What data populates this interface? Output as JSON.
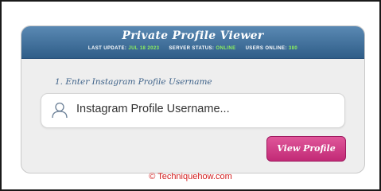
{
  "header": {
    "title": "Private Profile Viewer",
    "status": {
      "last_update_label": "LAST UPDATE:",
      "last_update_value": "JUL 18 2023",
      "server_status_label": "SERVER STATUS:",
      "server_status_value": "ONLINE",
      "users_online_label": "USERS ONLINE:",
      "users_online_value": "380"
    }
  },
  "form": {
    "step_label": "1. Enter Instagram Profile Username",
    "input_placeholder": "Instagram Profile Username...",
    "input_icon": "user-icon",
    "button_label": "View Profile"
  },
  "footer": {
    "credit": "© Techniquehow.com"
  },
  "colors": {
    "header_bg": "#3d6a95",
    "status_value": "#8ef25e",
    "button_bg": "#d13d87",
    "credit_text": "#d11b1b",
    "step_label": "#3e6289"
  }
}
